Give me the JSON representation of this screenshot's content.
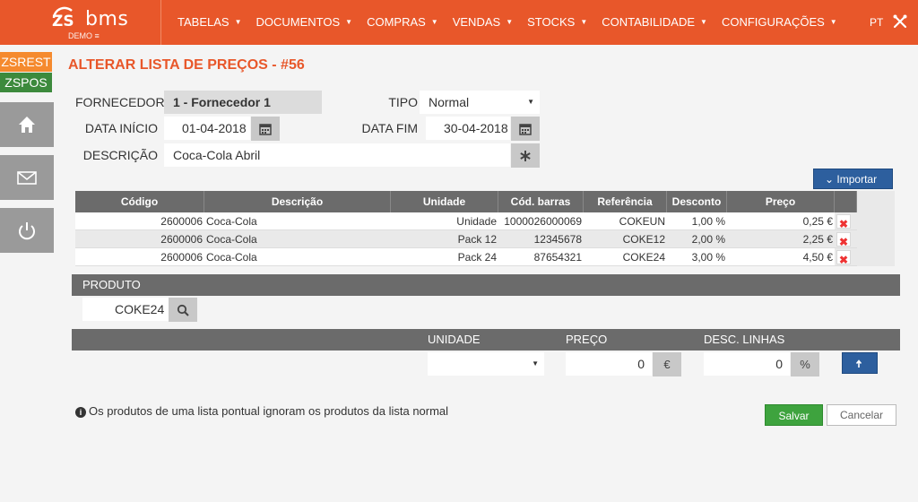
{
  "app": {
    "logo_text": "bms",
    "logo_prefix": "ZS",
    "demo_label": "DEMO",
    "lang": "PT"
  },
  "nav": [
    {
      "label": "TABELAS"
    },
    {
      "label": "DOCUMENTOS"
    },
    {
      "label": "COMPRAS"
    },
    {
      "label": "VENDAS"
    },
    {
      "label": "STOCKS"
    },
    {
      "label": "CONTABILIDADE"
    },
    {
      "label": "CONFIGURAÇÕES"
    }
  ],
  "sidebar": {
    "zsrest": "ZSREST",
    "zspos": "ZSPOS",
    "items": [
      "home-icon",
      "envelope-icon",
      "power-icon"
    ]
  },
  "page": {
    "title": "ALTERAR LISTA DE PREÇOS - #56"
  },
  "form": {
    "fornecedor_label": "FORNECEDOR",
    "fornecedor_value": "1 - Fornecedor 1",
    "tipo_label": "TIPO",
    "tipo_value": "Normal",
    "data_inicio_label": "DATA INÍCIO",
    "data_inicio_value": "01-04-2018",
    "data_fim_label": "DATA FIM",
    "data_fim_value": "30-04-2018",
    "descricao_label": "DESCRIÇÃO",
    "descricao_value": "Coca-Cola Abril"
  },
  "import_label": "Importar",
  "table": {
    "headers": [
      "Código",
      "Descrição",
      "Unidade",
      "Cód. barras",
      "Referência",
      "Desconto",
      "Preço"
    ],
    "rows": [
      {
        "codigo": "2600006",
        "descricao": "Coca-Cola",
        "unidade": "Unidade",
        "cod_barras": "1000026000069",
        "referencia": "COKEUN",
        "desconto": "1,00 %",
        "preco": "0,25 €"
      },
      {
        "codigo": "2600006",
        "descricao": "Coca-Cola",
        "unidade": "Pack 12",
        "cod_barras": "12345678",
        "referencia": "COKE12",
        "desconto": "2,00 %",
        "preco": "2,25 €"
      },
      {
        "codigo": "2600006",
        "descricao": "Coca-Cola",
        "unidade": "Pack 24",
        "cod_barras": "87654321",
        "referencia": "COKE24",
        "desconto": "3,00 %",
        "preco": "4,50 €"
      }
    ]
  },
  "produto": {
    "label": "PRODUTO",
    "value": "COKE24"
  },
  "line": {
    "unidade_label": "UNIDADE",
    "unidade_value": "",
    "preco_label": "PREÇO",
    "preco_value": "0",
    "preco_unit": "€",
    "desc_label": "DESC. LINHAS",
    "desc_value": "0",
    "desc_unit": "%"
  },
  "info_text": "Os produtos de uma lista pontual ignoram os produtos da lista normal",
  "buttons": {
    "save": "Salvar",
    "cancel": "Cancelar"
  },
  "colors": {
    "brand": "#e8572a",
    "save": "#3ea33e",
    "primary": "#2d5f9e"
  }
}
